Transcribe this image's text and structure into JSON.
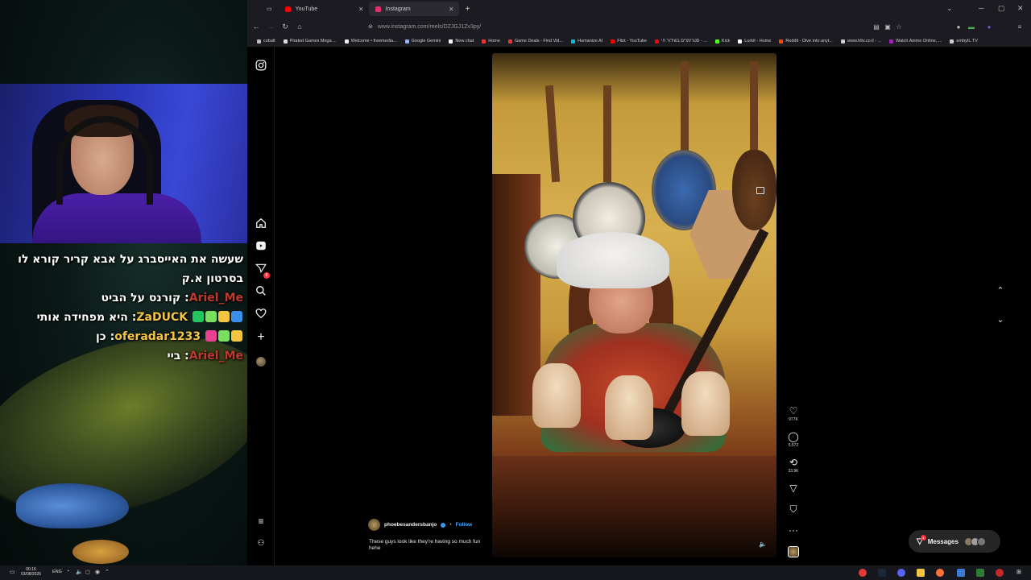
{
  "stream": {
    "chat": [
      {
        "user": "",
        "text": "שעשה את האייסברג על אבא קריר קורא לו בסרטון א.ק",
        "user_class": "",
        "badges": []
      },
      {
        "user": "Ariel_Me",
        "text": "קורנס על הביט",
        "user_class": "",
        "badges": []
      },
      {
        "user": "ZaDUCK",
        "text": "היא מפחידה אותי",
        "user_class": "y",
        "badges": [
          "#3a8fe8",
          "#f5c542",
          "#7adf60",
          "#22c55e"
        ]
      },
      {
        "user": "oferadar1233",
        "text": "כן",
        "user_class": "y",
        "badges": [
          "#f5c542",
          "#7adf60",
          "#e84393"
        ]
      },
      {
        "user": "Ariel_Me",
        "text": "ביי",
        "user_class": "",
        "badges": []
      }
    ]
  },
  "browser": {
    "tabs": [
      {
        "label": "YouTube",
        "color": "#ff0000"
      },
      {
        "label": "Instagram",
        "color": "#e1306c"
      }
    ],
    "url": "www.instagram.com/reels/DZJGJ1Zv3py/",
    "bookmarks": [
      {
        "label": "cobalt",
        "color": "#bbbbbb"
      },
      {
        "label": "Pirated Games Mega ...",
        "color": "#dddddd"
      },
      {
        "label": "Welcome • freemedia...",
        "color": "#eeeeee"
      },
      {
        "label": "Google Gemini",
        "color": "#8ab4f8"
      },
      {
        "label": "New chat",
        "color": "#ffffff"
      },
      {
        "label": "Home",
        "color": "#e53935"
      },
      {
        "label": "Game Deals - Find Vid...",
        "color": "#e53935"
      },
      {
        "label": "Humanize AI",
        "color": "#00bcd4"
      },
      {
        "label": "Flint - YouTube",
        "color": "#ff0000"
      },
      {
        "label": "סטרימרים בשידור חי - ...",
        "color": "#ff0000"
      },
      {
        "label": "Kick",
        "color": "#53fc18"
      },
      {
        "label": "Lurkit - Home",
        "color": "#ffffff"
      },
      {
        "label": "Reddit - Dive into anyt...",
        "color": "#ff4500"
      },
      {
        "label": "www.hltv.co.il - ...",
        "color": "#cccccc"
      },
      {
        "label": "Watch Anime Online, ...",
        "color": "#9c27b0"
      },
      {
        "label": "embyIL.TV",
        "color": "#cccccc"
      }
    ]
  },
  "instagram": {
    "notifications_count": "6",
    "likes": "977K",
    "comments": "5,572",
    "reposts": "33.9K",
    "author": "phoebesandersbanjo",
    "follow": "Follow",
    "separator": "•",
    "caption": "These guys look like they're having so much fun hehe",
    "messages_label": "Messages",
    "messages_count": "1"
  },
  "taskbar": {
    "time": "00:16",
    "date": "03/08/2026",
    "lang": "ENG"
  },
  "colors": {
    "accent_blue": "#4aa8ff",
    "notif_red": "#ff3040"
  }
}
